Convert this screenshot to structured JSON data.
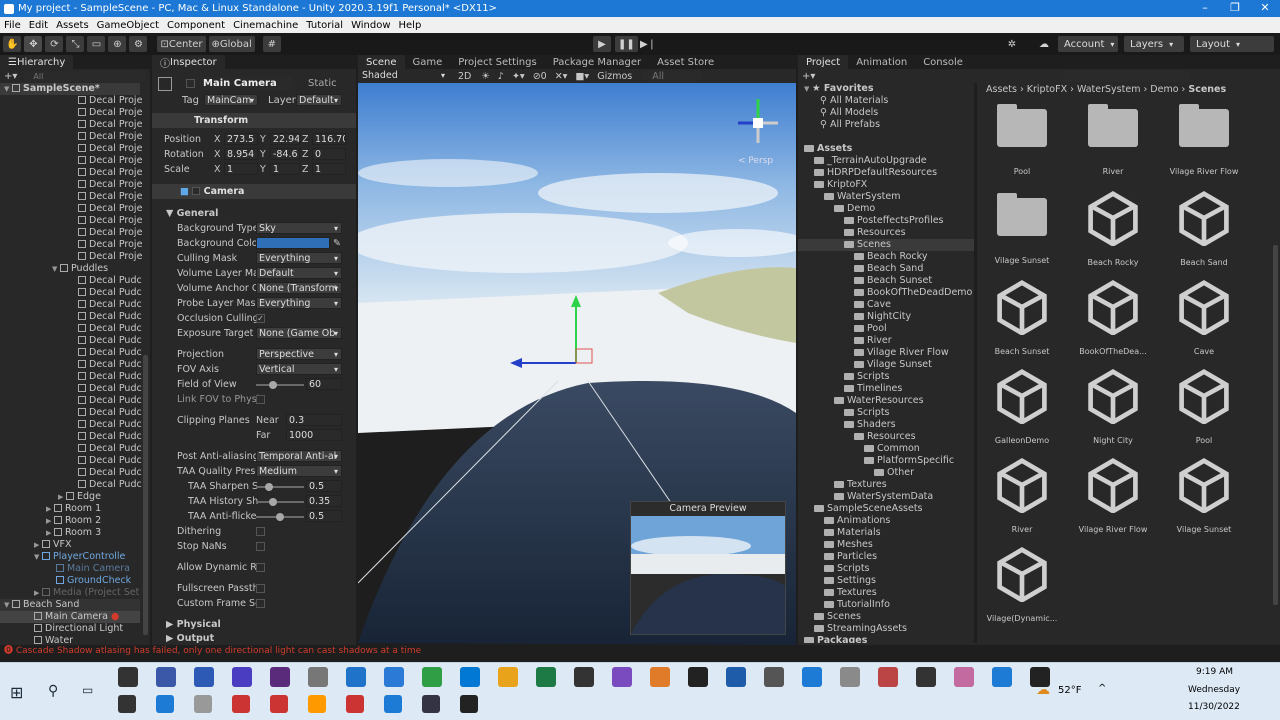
{
  "window": {
    "title": "My project - SampleScene - PC, Mac & Linux Standalone - Unity 2020.3.19f1 Personal* <DX11>"
  },
  "menu": [
    "File",
    "Edit",
    "Assets",
    "GameObject",
    "Component",
    "Cinemachine",
    "Tutorial",
    "Window",
    "Help"
  ],
  "toolbar": {
    "center": "Center",
    "global": "Global",
    "account": "Account",
    "layers": "Layers",
    "layout": "Layout"
  },
  "hierarchy": {
    "tab": "Hierarchy",
    "search": "All",
    "scene": "SampleScene*",
    "items": [
      "Decal Proje",
      "Decal Proje",
      "Decal Proje",
      "Decal Proje",
      "Decal Proje",
      "Decal Proje",
      "Decal Proje",
      "Decal Proje",
      "Decal Proje",
      "Decal Proje",
      "Decal Proje",
      "Decal Proje",
      "Decal Proje",
      "Decal Proje"
    ],
    "puddles": "Puddles",
    "puddle_items": [
      "Decal Pudc",
      "Decal Pudc",
      "Decal Pudc",
      "Decal Pudc",
      "Decal Pudc",
      "Decal Pudc",
      "Decal Pudc",
      "Decal Pudc",
      "Decal Pudc",
      "Decal Pudc",
      "Decal Pudc",
      "Decal Pudc",
      "Decal Pudc",
      "Decal Pudc",
      "Decal Pudc",
      "Decal Pudc",
      "Decal Pudc",
      "Decal Pudc"
    ],
    "edge": "Edge",
    "rooms": [
      "Room 1",
      "Room 2",
      "Room 3"
    ],
    "vfx": "VFX",
    "player": "PlayerControlle",
    "main_cam_dim": "Main Camera",
    "ground": "GroundCheck",
    "media": "Media (Project Set",
    "beach": "Beach Sand",
    "beach_items": [
      "Main Camera",
      "Directional Light",
      "Water"
    ]
  },
  "inspector": {
    "tab": "Inspector",
    "name": "Main Camera",
    "static": "Static",
    "tag_label": "Tag",
    "tag": "MainCam",
    "layer_label": "Layer",
    "layer": "Default",
    "transform": "Transform",
    "position": "Position",
    "pos": [
      "273.5",
      "22.94",
      "116.70"
    ],
    "rotation": "Rotation",
    "rot": [
      "8.954",
      "-84.6",
      "0"
    ],
    "scale": "Scale",
    "scl": [
      "1",
      "1",
      "1"
    ],
    "camera": "Camera",
    "general": "General",
    "rows": [
      {
        "l": "Background Type",
        "v": "Sky"
      },
      {
        "l": "Background Color",
        "v": ""
      },
      {
        "l": "Culling Mask",
        "v": "Everything"
      },
      {
        "l": "Volume Layer Ma",
        "v": "Default"
      },
      {
        "l": "Volume Anchor Ov",
        "v": "None (Transform"
      },
      {
        "l": "Probe Layer Mask",
        "v": "Everything"
      },
      {
        "l": "Occlusion Culling",
        "v": "✓"
      },
      {
        "l": "Exposure Target",
        "v": "None (Game Ob"
      }
    ],
    "projection_label": "Projection",
    "projection": "Perspective",
    "fov_axis_label": "FOV Axis",
    "fov_axis": "Vertical",
    "fov_label": "Field of View",
    "fov": "60",
    "link_fov": "Link FOV to Physi",
    "clipping": "Clipping Planes",
    "near_label": "Near",
    "near": "0.3",
    "far_label": "Far",
    "far": "1000",
    "post_aa_label": "Post Anti-aliasing",
    "post_aa": "Temporal Anti-al",
    "taa_q_label": "TAA Quality Prese",
    "taa_q": "Medium",
    "taa_sharp": "TAA Sharpen S",
    "taa_sharp_v": "0.5",
    "taa_hist": "TAA History Sh",
    "taa_hist_v": "0.35",
    "taa_flick": "TAA Anti-flicke",
    "taa_flick_v": "0.5",
    "dithering": "Dithering",
    "stopnans": "Stop NaNs",
    "allowdyn": "Allow Dynamic Re",
    "fullscreen": "Fullscreen Passth",
    "customframe": "Custom Frame Set",
    "physical": "Physical",
    "output": "Output"
  },
  "scene": {
    "tabs": [
      "Scene",
      "Game",
      "Project Settings",
      "Package Manager",
      "Asset Store"
    ],
    "shaded": "Shaded",
    "twod": "2D",
    "gizmos": "Gizmos",
    "search": "All",
    "persp": "< Persp",
    "preview": "Camera Preview",
    "zero": "0"
  },
  "project": {
    "tabs": [
      "Project",
      "Animation",
      "Console"
    ],
    "breadcrumb": [
      "Assets",
      "KriptoFX",
      "WaterSystem",
      "Demo",
      "Scenes"
    ],
    "favorites": "Favorites",
    "fav_items": [
      "All Materials",
      "All Models",
      "All Prefabs"
    ],
    "tree": [
      {
        "t": "Assets",
        "d": 0,
        "b": 1
      },
      {
        "t": "_TerrainAutoUpgrade",
        "d": 1
      },
      {
        "t": "HDRPDefaultResources",
        "d": 1
      },
      {
        "t": "KriptoFX",
        "d": 1
      },
      {
        "t": "WaterSystem",
        "d": 2
      },
      {
        "t": "Demo",
        "d": 3
      },
      {
        "t": "PosteffectsProfiles",
        "d": 4
      },
      {
        "t": "Resources",
        "d": 4
      },
      {
        "t": "Scenes",
        "d": 4,
        "s": 1
      },
      {
        "t": "Beach Rocky",
        "d": 5
      },
      {
        "t": "Beach Sand",
        "d": 5
      },
      {
        "t": "Beach Sunset",
        "d": 5
      },
      {
        "t": "BookOfTheDeadDemo",
        "d": 5
      },
      {
        "t": "Cave",
        "d": 5
      },
      {
        "t": "NightCity",
        "d": 5
      },
      {
        "t": "Pool",
        "d": 5
      },
      {
        "t": "River",
        "d": 5
      },
      {
        "t": "Vilage River Flow",
        "d": 5
      },
      {
        "t": "Vilage Sunset",
        "d": 5
      },
      {
        "t": "Scripts",
        "d": 4
      },
      {
        "t": "Timelines",
        "d": 4
      },
      {
        "t": "WaterResources",
        "d": 3
      },
      {
        "t": "Scripts",
        "d": 4
      },
      {
        "t": "Shaders",
        "d": 4
      },
      {
        "t": "Resources",
        "d": 5
      },
      {
        "t": "Common",
        "d": 6
      },
      {
        "t": "PlatformSpecific",
        "d": 6
      },
      {
        "t": "Other",
        "d": 7
      },
      {
        "t": "Textures",
        "d": 3
      },
      {
        "t": "WaterSystemData",
        "d": 3
      },
      {
        "t": "SampleSceneAssets",
        "d": 1
      },
      {
        "t": "Animations",
        "d": 2
      },
      {
        "t": "Materials",
        "d": 2
      },
      {
        "t": "Meshes",
        "d": 2
      },
      {
        "t": "Particles",
        "d": 2
      },
      {
        "t": "Scripts",
        "d": 2
      },
      {
        "t": "Settings",
        "d": 2
      },
      {
        "t": "Textures",
        "d": 2
      },
      {
        "t": "TutorialInfo",
        "d": 2
      },
      {
        "t": "Scenes",
        "d": 1
      },
      {
        "t": "StreamingAssets",
        "d": 1
      },
      {
        "t": "Packages",
        "d": 0,
        "b": 1
      }
    ],
    "grid": [
      {
        "n": "Pool",
        "f": 1
      },
      {
        "n": "River",
        "f": 1
      },
      {
        "n": "Vilage River Flow",
        "f": 1
      },
      {
        "n": "Vilage Sunset",
        "f": 1
      },
      {
        "n": "Beach Rocky"
      },
      {
        "n": "Beach Sand"
      },
      {
        "n": "Beach Sunset"
      },
      {
        "n": "BookOfTheDea..."
      },
      {
        "n": "Cave"
      },
      {
        "n": "GalleonDemo"
      },
      {
        "n": "Night City"
      },
      {
        "n": "Pool"
      },
      {
        "n": "River"
      },
      {
        "n": "Vilage River Flow"
      },
      {
        "n": "Vilage Sunset"
      },
      {
        "n": "Vilage(Dynamic..."
      }
    ]
  },
  "status": "Cascade Shadow atlasing has failed, only one directional light can cast shadows at a time",
  "taskbar": {
    "temp": "52°F",
    "time": "9:19 AM",
    "day": "Wednesday",
    "date": "11/30/2022"
  },
  "colors": {
    "accent": "#1c78d4",
    "bg_color": "#2f6fb8",
    "error": "#d23b2b",
    "sky": "#3a7fd0"
  }
}
